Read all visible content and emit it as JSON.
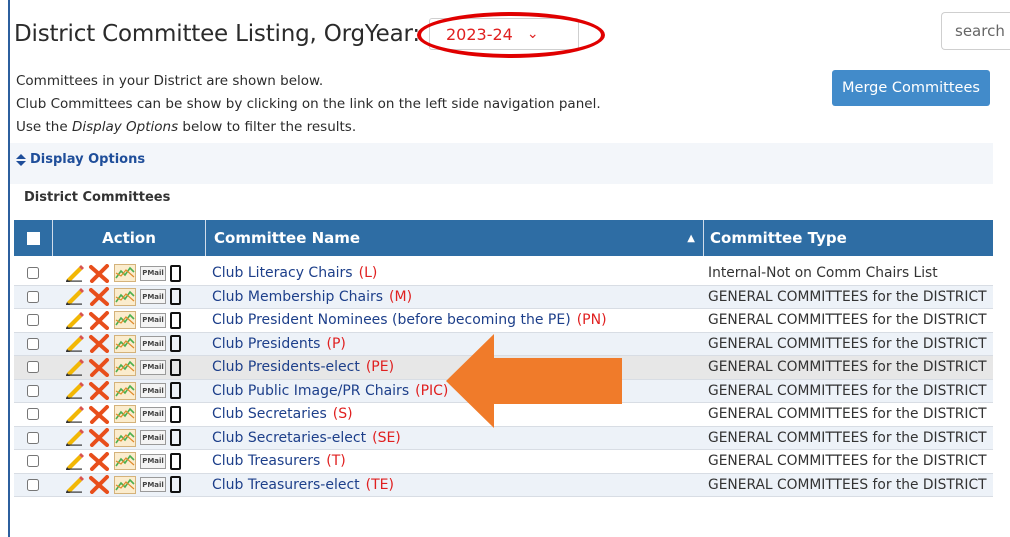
{
  "header": {
    "title": "District Committee Listing, OrgYear:",
    "orgyear_value": "2023-24",
    "search_placeholder": "search"
  },
  "intro": {
    "line1": "Committees in your District are shown below.",
    "line2": "Club Committees can be show by clicking on the link on the left side navigation panel.",
    "line3_prefix": "Use the ",
    "line3_em": "Display Options",
    "line3_suffix": " below to filter the results."
  },
  "merge_label": "Merge Committees",
  "display_options_label": "Display Options",
  "section_title": "District Committees",
  "table": {
    "columns": {
      "action": "Action",
      "name": "Committee Name",
      "type": "Committee Type"
    },
    "pmail_label": "PMail",
    "rows": [
      {
        "name": "Club Literacy Chairs",
        "code": "(L)",
        "type": "Internal-Not on Comm Chairs List"
      },
      {
        "name": "Club Membership Chairs",
        "code": "(M)",
        "type": "GENERAL COMMITTEES for the DISTRICT"
      },
      {
        "name": "Club President Nominees (before becoming the PE)",
        "code": "(PN)",
        "type": "GENERAL COMMITTEES for the DISTRICT"
      },
      {
        "name": "Club Presidents",
        "code": "(P)",
        "type": "GENERAL COMMITTEES for the DISTRICT"
      },
      {
        "name": "Club Presidents-elect",
        "code": "(PE)",
        "type": "GENERAL COMMITTEES for the DISTRICT"
      },
      {
        "name": "Club Public Image/PR Chairs",
        "code": "(PIC)",
        "type": "GENERAL COMMITTEES for the DISTRICT"
      },
      {
        "name": "Club Secretaries",
        "code": "(S)",
        "type": "GENERAL COMMITTEES for the DISTRICT"
      },
      {
        "name": "Club Secretaries-elect",
        "code": "(SE)",
        "type": "GENERAL COMMITTEES for the DISTRICT"
      },
      {
        "name": "Club Treasurers",
        "code": "(T)",
        "type": "GENERAL COMMITTEES for the DISTRICT"
      },
      {
        "name": "Club Treasurers-elect",
        "code": "(TE)",
        "type": "GENERAL COMMITTEES for the DISTRICT"
      }
    ]
  },
  "colors": {
    "header_bg": "#2e6da4",
    "accent_red": "#e02020",
    "link_blue": "#1d3f8a",
    "button_blue": "#428bca",
    "arrow_orange": "#f07b2a"
  }
}
